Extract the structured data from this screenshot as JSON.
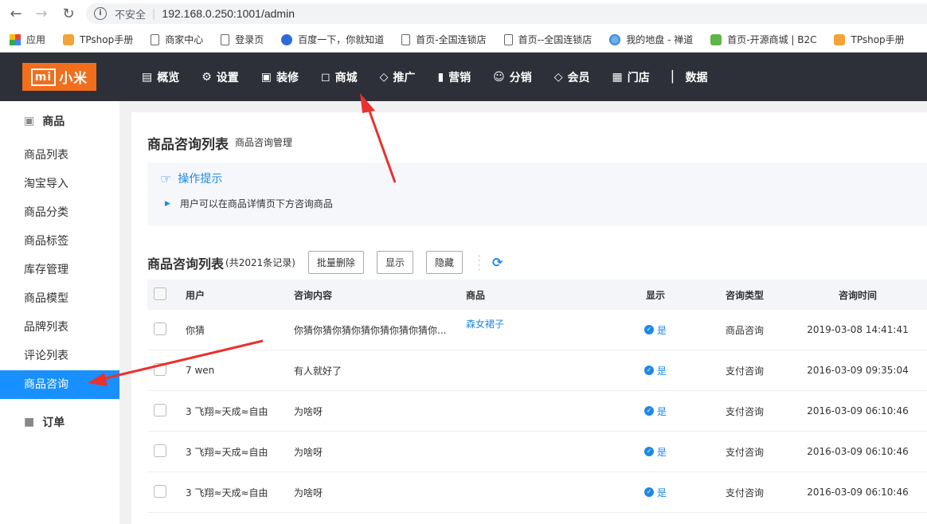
{
  "browser": {
    "insecure_label": "不安全",
    "url": "192.168.0.250:1001/admin",
    "bookmarks": [
      {
        "label": "应用",
        "icon": "apps-grid-icon"
      },
      {
        "label": "TPshop手册",
        "icon": "tpshop-icon"
      },
      {
        "label": "商家中心",
        "icon": "page-icon"
      },
      {
        "label": "登录页",
        "icon": "page-icon"
      },
      {
        "label": "百度一下，你就知道",
        "icon": "baidu-paw-icon"
      },
      {
        "label": "首页-全国连锁店",
        "icon": "page-icon"
      },
      {
        "label": "首页--全国连锁店",
        "icon": "page-icon"
      },
      {
        "label": "我的地盘 - 禅道",
        "icon": "globe-icon"
      },
      {
        "label": "首页-开源商城 | B2C",
        "icon": "leaf-icon"
      },
      {
        "label": "TPshop手册",
        "icon": "tpshop-icon"
      }
    ]
  },
  "logo": {
    "mi": "mi",
    "text": "小米"
  },
  "topnav": [
    {
      "label": "概览",
      "icon": "monitor-icon"
    },
    {
      "label": "设置",
      "icon": "gear-icon"
    },
    {
      "label": "装修",
      "icon": "layout-icon"
    },
    {
      "label": "商城",
      "icon": "bag-icon"
    },
    {
      "label": "推广",
      "icon": "diamond-icon"
    },
    {
      "label": "营销",
      "icon": "bar-chart-icon"
    },
    {
      "label": "分销",
      "icon": "users-icon"
    },
    {
      "label": "会员",
      "icon": "diamond-icon"
    },
    {
      "label": "门店",
      "icon": "store-icon"
    },
    {
      "label": "数据",
      "icon": "stats-icon"
    }
  ],
  "sidebar": {
    "section": "商品",
    "items": [
      "商品列表",
      "淘宝导入",
      "商品分类",
      "商品标签",
      "库存管理",
      "商品模型",
      "品牌列表",
      "评论列表",
      "商品咨询"
    ],
    "active_index": 8,
    "order_section": "订单"
  },
  "page": {
    "title": "商品咨询列表",
    "subtitle": "商品咨询管理",
    "tips_title": "操作提示",
    "tips_text": "用户可以在商品详情页下方咨询商品"
  },
  "list": {
    "title": "商品咨询列表",
    "count": "(共2021条记录)",
    "buttons": {
      "batch_delete": "批量删除",
      "show": "显示",
      "hide": "隐藏"
    },
    "columns": {
      "user": "用户",
      "content": "咨询内容",
      "goods": "商品",
      "show": "显示",
      "type": "咨询类型",
      "time": "咨询时间"
    },
    "rows": [
      {
        "user": "你猜",
        "content": "你猜你猜你猜你猜你猜你猜你猜你...",
        "goods": "森女裙子",
        "show": "是",
        "type": "商品咨询",
        "time": "2019-03-08 14:41:41"
      },
      {
        "user": "7 wen",
        "content": "有人就好了",
        "goods": "",
        "show": "是",
        "type": "支付咨询",
        "time": "2016-03-09 09:35:04"
      },
      {
        "user": "3 飞翔≈天成≈自由",
        "content": "为啥呀",
        "goods": "",
        "show": "是",
        "type": "支付咨询",
        "time": "2016-03-09 06:10:46"
      },
      {
        "user": "3 飞翔≈天成≈自由",
        "content": "为啥呀",
        "goods": "",
        "show": "是",
        "type": "支付咨询",
        "time": "2016-03-09 06:10:46"
      },
      {
        "user": "3 飞翔≈天成≈自由",
        "content": "为啥呀",
        "goods": "",
        "show": "是",
        "type": "支付咨询",
        "time": "2016-03-09 06:10:46"
      }
    ]
  },
  "colors": {
    "accent": "#1890ff",
    "topbar": "#2d3038",
    "logo": "#f16e1d",
    "arrow": "#e8322f"
  }
}
